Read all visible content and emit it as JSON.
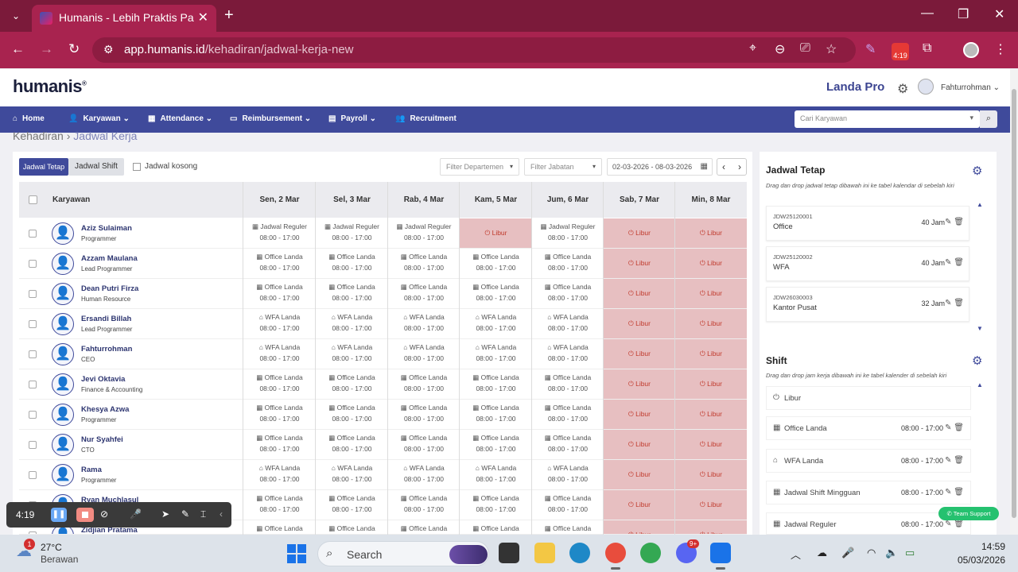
{
  "browser": {
    "tab_title": "Humanis - Lebih Praktis Pakai H",
    "url_host": "app.humanis.id",
    "url_path": "/kehadiran/jadwal-kerja-new",
    "ext_badge": "4:19"
  },
  "header": {
    "logo": "humanis",
    "company": "Landa Pro",
    "user": "Fahturrohman"
  },
  "menu": [
    {
      "label": "Home",
      "icon": "home-icon"
    },
    {
      "label": "Karyawan",
      "icon": "user-check-icon"
    },
    {
      "label": "Attendance",
      "icon": "calendar-icon"
    },
    {
      "label": "Reimbursement",
      "icon": "money-icon"
    },
    {
      "label": "Payroll",
      "icon": "book-icon"
    },
    {
      "label": "Recruitment",
      "icon": "users-icon"
    }
  ],
  "search_employee_placeholder": "Cari Karyawan",
  "breadcrumb": {
    "root": "Kehadiran",
    "current": "Jadwal Kerja"
  },
  "toolbar": {
    "btn_tetap": "Jadwal Tetap",
    "btn_shift": "Jadwal Shift",
    "chk_kosong": "Jadwal kosong",
    "filter_dept": "Filter Departemen",
    "filter_jabatan": "Filter Jabatan",
    "date_range": "02-03-2026 - 08-03-2026"
  },
  "table": {
    "col_employee": "Karyawan",
    "days": [
      "Sen, 2 Mar",
      "Sel, 3 Mar",
      "Rab, 4 Mar",
      "Kam, 5 Mar",
      "Jum, 6 Mar",
      "Sab, 7 Mar",
      "Min, 8 Mar"
    ],
    "rows": [
      {
        "name": "Aziz Sulaiman",
        "role": "Programmer",
        "cells": [
          [
            "Jadwal Reguler",
            "08:00 - 17:00"
          ],
          [
            "Jadwal Reguler",
            "08:00 - 17:00"
          ],
          [
            "Jadwal Reguler",
            "08:00 - 17:00"
          ],
          [
            "Libur",
            ""
          ],
          [
            "Jadwal Reguler",
            "08:00 - 17:00"
          ],
          [
            "Libur",
            ""
          ],
          [
            "Libur",
            ""
          ]
        ]
      },
      {
        "name": "Azzam Maulana",
        "role": "Lead Programmer",
        "cells": [
          [
            "Office Landa",
            "08:00 - 17:00"
          ],
          [
            "Office Landa",
            "08:00 - 17:00"
          ],
          [
            "Office Landa",
            "08:00 - 17:00"
          ],
          [
            "Office Landa",
            "08:00 - 17:00"
          ],
          [
            "Office Landa",
            "08:00 - 17:00"
          ],
          [
            "Libur",
            ""
          ],
          [
            "Libur",
            ""
          ]
        ]
      },
      {
        "name": "Dean Putri Firza",
        "role": "Human Resource",
        "cells": [
          [
            "Office Landa",
            "08:00 - 17:00"
          ],
          [
            "Office Landa",
            "08:00 - 17:00"
          ],
          [
            "Office Landa",
            "08:00 - 17:00"
          ],
          [
            "Office Landa",
            "08:00 - 17:00"
          ],
          [
            "Office Landa",
            "08:00 - 17:00"
          ],
          [
            "Libur",
            ""
          ],
          [
            "Libur",
            ""
          ]
        ]
      },
      {
        "name": "Ersandi Billah",
        "role": "Lead Programmer",
        "cells": [
          [
            "WFA Landa",
            "08:00 - 17:00"
          ],
          [
            "WFA Landa",
            "08:00 - 17:00"
          ],
          [
            "WFA Landa",
            "08:00 - 17:00"
          ],
          [
            "WFA Landa",
            "08:00 - 17:00"
          ],
          [
            "WFA Landa",
            "08:00 - 17:00"
          ],
          [
            "Libur",
            ""
          ],
          [
            "Libur",
            ""
          ]
        ]
      },
      {
        "name": "Fahturrohman",
        "role": "CEO",
        "cells": [
          [
            "WFA Landa",
            "08:00 - 17:00"
          ],
          [
            "WFA Landa",
            "08:00 - 17:00"
          ],
          [
            "WFA Landa",
            "08:00 - 17:00"
          ],
          [
            "WFA Landa",
            "08:00 - 17:00"
          ],
          [
            "WFA Landa",
            "08:00 - 17:00"
          ],
          [
            "Libur",
            ""
          ],
          [
            "Libur",
            ""
          ]
        ]
      },
      {
        "name": "Jevi Oktavia",
        "role": "Finance & Accounting",
        "cells": [
          [
            "Office Landa",
            "08:00 - 17:00"
          ],
          [
            "Office Landa",
            "08:00 - 17:00"
          ],
          [
            "Office Landa",
            "08:00 - 17:00"
          ],
          [
            "Office Landa",
            "08:00 - 17:00"
          ],
          [
            "Office Landa",
            "08:00 - 17:00"
          ],
          [
            "Libur",
            ""
          ],
          [
            "Libur",
            ""
          ]
        ]
      },
      {
        "name": "Khesya Azwa",
        "role": "Programmer",
        "cells": [
          [
            "Office Landa",
            "08:00 - 17:00"
          ],
          [
            "Office Landa",
            "08:00 - 17:00"
          ],
          [
            "Office Landa",
            "08:00 - 17:00"
          ],
          [
            "Office Landa",
            "08:00 - 17:00"
          ],
          [
            "Office Landa",
            "08:00 - 17:00"
          ],
          [
            "Libur",
            ""
          ],
          [
            "Libur",
            ""
          ]
        ]
      },
      {
        "name": "Nur Syahfei",
        "role": "CTO",
        "cells": [
          [
            "Office Landa",
            "08:00 - 17:00"
          ],
          [
            "Office Landa",
            "08:00 - 17:00"
          ],
          [
            "Office Landa",
            "08:00 - 17:00"
          ],
          [
            "Office Landa",
            "08:00 - 17:00"
          ],
          [
            "Office Landa",
            "08:00 - 17:00"
          ],
          [
            "Libur",
            ""
          ],
          [
            "Libur",
            ""
          ]
        ]
      },
      {
        "name": "Rama",
        "role": "Programmer",
        "cells": [
          [
            "WFA Landa",
            "08:00 - 17:00"
          ],
          [
            "WFA Landa",
            "08:00 - 17:00"
          ],
          [
            "WFA Landa",
            "08:00 - 17:00"
          ],
          [
            "WFA Landa",
            "08:00 - 17:00"
          ],
          [
            "WFA Landa",
            "08:00 - 17:00"
          ],
          [
            "Libur",
            ""
          ],
          [
            "Libur",
            ""
          ]
        ]
      },
      {
        "name": "Ryan Muchlasul",
        "role": "",
        "cells": [
          [
            "Office Landa",
            "08:00 - 17:00"
          ],
          [
            "Office Landa",
            "08:00 - 17:00"
          ],
          [
            "Office Landa",
            "08:00 - 17:00"
          ],
          [
            "Office Landa",
            "08:00 - 17:00"
          ],
          [
            "Office Landa",
            "08:00 - 17:00"
          ],
          [
            "Libur",
            ""
          ],
          [
            "Libur",
            ""
          ]
        ]
      },
      {
        "name": "Zidjian Pratama",
        "role": "",
        "cells": [
          [
            "Office Landa",
            ""
          ],
          [
            "Office Landa",
            ""
          ],
          [
            "Office Landa",
            ""
          ],
          [
            "Office Landa",
            ""
          ],
          [
            "Office Landa",
            ""
          ],
          [
            "Libur",
            ""
          ],
          [
            "Libur",
            ""
          ]
        ]
      }
    ]
  },
  "jadwal_tetap": {
    "title": "Jadwal Tetap",
    "desc": "Drag dan drop jadwal tetap dibawah ini ke tabel kalendar di sebelah kiri",
    "items": [
      {
        "code": "JDW25120001",
        "name": "Office",
        "hours": "40 Jam"
      },
      {
        "code": "JDW25120002",
        "name": "WFA",
        "hours": "40 Jam"
      },
      {
        "code": "JDW26030003",
        "name": "Kantor Pusat",
        "hours": "32 Jam"
      }
    ]
  },
  "shift": {
    "title": "Shift",
    "desc": "Drag dan drop jam kerja dibawah ini ke tabel kalender di sebelah kiri",
    "items": [
      {
        "name": "Libur",
        "time": ""
      },
      {
        "name": "Office Landa",
        "time": "08:00 - 17:00"
      },
      {
        "name": "WFA Landa",
        "time": "08:00 - 17:00"
      },
      {
        "name": "Jadwal Shift Mingguan",
        "time": "08:00 - 17:00"
      },
      {
        "name": "Jadwal Reguler",
        "time": "08:00 - 17:00"
      }
    ]
  },
  "team_support": "Team Support",
  "recorder": {
    "time": "4:19"
  },
  "taskbar": {
    "weather_temp": "27°C",
    "weather_desc": "Berawan",
    "weather_badge": "1",
    "search_label": "Search",
    "discord_badge": "9+",
    "time": "14:59",
    "date": "05/03/2026"
  },
  "colors": {
    "brand": "#3f4a9b",
    "browser": "#a8234f",
    "libur_bg": "#e7bfc1",
    "libur_text": "#c0392b"
  }
}
